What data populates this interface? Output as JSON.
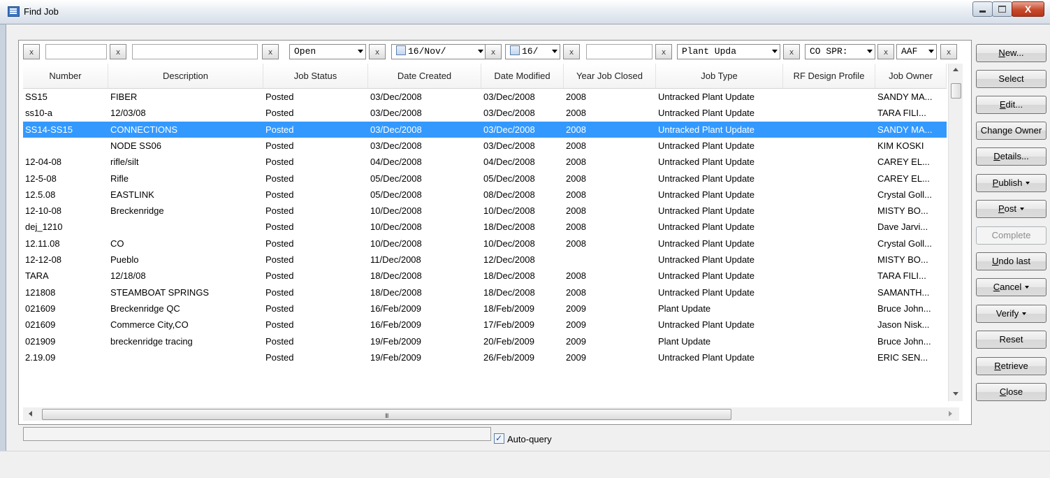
{
  "window": {
    "title": "Find Job",
    "minimize_label": "",
    "maximize_label": "",
    "close_label": "X"
  },
  "filters": {
    "clear_label": "x",
    "job_status": "Open",
    "date_created": "16/Nov/",
    "date_modified": "16/",
    "job_type": "Plant Upda",
    "rf_design_profile": "CO SPR:",
    "job_owner": "AAF"
  },
  "columns": [
    "Number",
    "Description",
    "Job Status",
    "Date Created",
    "Date Modified",
    "Year Job Closed",
    "Job Type",
    "RF Design Profile",
    "Job Owner"
  ],
  "rows": [
    {
      "number": "SS15",
      "description": "FIBER",
      "status": "Posted",
      "created": "03/Dec/2008",
      "modified": "03/Dec/2008",
      "year_closed": "2008",
      "job_type": "Untracked Plant Update",
      "rf_profile": "",
      "owner": "SANDY MA..."
    },
    {
      "number": "ss10-a",
      "description": "12/03/08",
      "status": "Posted",
      "created": "03/Dec/2008",
      "modified": "03/Dec/2008",
      "year_closed": "2008",
      "job_type": "Untracked Plant Update",
      "rf_profile": "",
      "owner": "TARA FILI..."
    },
    {
      "number": "SS14-SS15",
      "description": "CONNECTIONS",
      "status": "Posted",
      "created": "03/Dec/2008",
      "modified": "03/Dec/2008",
      "year_closed": "2008",
      "job_type": "Untracked Plant Update",
      "rf_profile": "",
      "owner": "SANDY MA..."
    },
    {
      "number": "",
      "description": "NODE SS06",
      "status": "Posted",
      "created": "03/Dec/2008",
      "modified": "03/Dec/2008",
      "year_closed": "2008",
      "job_type": "Untracked Plant Update",
      "rf_profile": "",
      "owner": "KIM KOSKI"
    },
    {
      "number": "12-04-08",
      "description": "rifle/silt",
      "status": "Posted",
      "created": "04/Dec/2008",
      "modified": "04/Dec/2008",
      "year_closed": "2008",
      "job_type": "Untracked Plant Update",
      "rf_profile": "",
      "owner": "CAREY EL..."
    },
    {
      "number": "12-5-08",
      "description": "Rifle",
      "status": "Posted",
      "created": "05/Dec/2008",
      "modified": "05/Dec/2008",
      "year_closed": "2008",
      "job_type": "Untracked Plant Update",
      "rf_profile": "",
      "owner": "CAREY EL..."
    },
    {
      "number": "12.5.08",
      "description": "EASTLINK",
      "status": "Posted",
      "created": "05/Dec/2008",
      "modified": "08/Dec/2008",
      "year_closed": "2008",
      "job_type": "Untracked Plant Update",
      "rf_profile": "",
      "owner": "Crystal Goll..."
    },
    {
      "number": "12-10-08",
      "description": "Breckenridge",
      "status": "Posted",
      "created": "10/Dec/2008",
      "modified": "10/Dec/2008",
      "year_closed": "2008",
      "job_type": "Untracked Plant Update",
      "rf_profile": "",
      "owner": "MISTY BO..."
    },
    {
      "number": "dej_1210",
      "description": "",
      "status": "Posted",
      "created": "10/Dec/2008",
      "modified": "18/Dec/2008",
      "year_closed": "2008",
      "job_type": "Untracked Plant Update",
      "rf_profile": "",
      "owner": "Dave Jarvi..."
    },
    {
      "number": "12.11.08",
      "description": "CO",
      "status": "Posted",
      "created": "10/Dec/2008",
      "modified": "10/Dec/2008",
      "year_closed": "2008",
      "job_type": "Untracked Plant Update",
      "rf_profile": "",
      "owner": "Crystal Goll..."
    },
    {
      "number": "12-12-08",
      "description": "Pueblo",
      "status": "Posted",
      "created": "11/Dec/2008",
      "modified": "12/Dec/2008",
      "year_closed": "",
      "job_type": "Untracked Plant Update",
      "rf_profile": "",
      "owner": "MISTY BO..."
    },
    {
      "number": "TARA",
      "description": "12/18/08",
      "status": "Posted",
      "created": "18/Dec/2008",
      "modified": "18/Dec/2008",
      "year_closed": "2008",
      "job_type": "Untracked Plant Update",
      "rf_profile": "",
      "owner": "TARA FILI..."
    },
    {
      "number": "121808",
      "description": "STEAMBOAT SPRINGS",
      "status": "Posted",
      "created": "18/Dec/2008",
      "modified": "18/Dec/2008",
      "year_closed": "2008",
      "job_type": "Untracked Plant Update",
      "rf_profile": "",
      "owner": "SAMANTH..."
    },
    {
      "number": "021609",
      "description": "Breckenridge QC",
      "status": "Posted",
      "created": "16/Feb/2009",
      "modified": "18/Feb/2009",
      "year_closed": "2009",
      "job_type": "Plant Update",
      "rf_profile": "",
      "owner": "Bruce John..."
    },
    {
      "number": "021609",
      "description": "Commerce City,CO",
      "status": "Posted",
      "created": "16/Feb/2009",
      "modified": "17/Feb/2009",
      "year_closed": "2009",
      "job_type": "Untracked Plant Update",
      "rf_profile": "",
      "owner": "Jason Nisk..."
    },
    {
      "number": "021909",
      "description": "breckenridge tracing",
      "status": "Posted",
      "created": "19/Feb/2009",
      "modified": "20/Feb/2009",
      "year_closed": "2009",
      "job_type": "Plant Update",
      "rf_profile": "",
      "owner": "Bruce John..."
    },
    {
      "number": "2.19.09",
      "description": "",
      "status": "Posted",
      "created": "19/Feb/2009",
      "modified": "26/Feb/2009",
      "year_closed": "2009",
      "job_type": "Untracked Plant Update",
      "rf_profile": "",
      "owner": "ERIC SEN..."
    }
  ],
  "selected_row_index": 2,
  "buttons": [
    {
      "label": "New...",
      "underline": "N",
      "rest": "ew...",
      "dropdown": false,
      "disabled": false
    },
    {
      "label": "Select",
      "underline": "",
      "rest": "Select",
      "dropdown": false,
      "disabled": false
    },
    {
      "label": "Edit...",
      "underline": "E",
      "rest": "dit...",
      "dropdown": false,
      "disabled": false
    },
    {
      "label": "Change Owner",
      "underline": "",
      "rest": "Change Owner",
      "dropdown": false,
      "disabled": false
    },
    {
      "label": "Details...",
      "underline": "D",
      "rest": "etails...",
      "dropdown": false,
      "disabled": false
    },
    {
      "label": "Publish",
      "underline": "P",
      "rest": "ublish",
      "dropdown": true,
      "disabled": false
    },
    {
      "label": "Post",
      "underline": "P",
      "rest": "ost",
      "dropdown": true,
      "disabled": false
    },
    {
      "label": "Complete",
      "underline": "",
      "rest": "Complete",
      "dropdown": false,
      "disabled": true
    },
    {
      "label": "Undo last",
      "underline": "U",
      "rest": "ndo last",
      "dropdown": false,
      "disabled": false
    },
    {
      "label": "Cancel",
      "underline": "C",
      "rest": "ancel",
      "dropdown": true,
      "disabled": false
    },
    {
      "label": "Verify",
      "underline": "",
      "rest": "Verify",
      "dropdown": true,
      "disabled": false
    },
    {
      "label": "Reset",
      "underline": "",
      "rest": "Reset",
      "dropdown": false,
      "disabled": false
    },
    {
      "label": "Retrieve",
      "underline": "R",
      "rest": "etrieve",
      "dropdown": false,
      "disabled": false
    },
    {
      "label": "Close",
      "underline": "C",
      "rest": "lose",
      "dropdown": false,
      "disabled": false
    }
  ],
  "status": {
    "message": "",
    "auto_query_label": "Auto-query",
    "auto_query_checked": true
  },
  "hscroll_grip": "III",
  "colors": {
    "selection": "#3399ff",
    "accent": "#3a76c4"
  }
}
